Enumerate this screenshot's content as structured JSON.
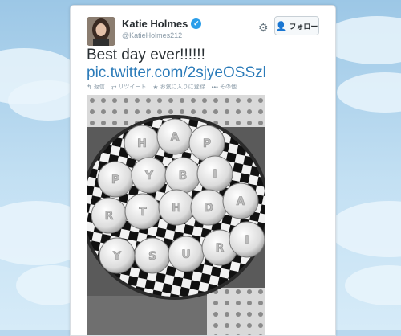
{
  "tweet": {
    "author_name": "Katie Holmes",
    "handle": "@KatieHolmes212",
    "follow_label": "フォロー",
    "text": "Best day ever!!!!!!",
    "link": "pic.twitter.com/2sjyeOSSzl",
    "actions": [
      {
        "icon": "reply-icon",
        "glyph": "↰",
        "label": "返信"
      },
      {
        "icon": "retweet-icon",
        "glyph": "⇄",
        "label": "リツイート"
      },
      {
        "icon": "favorite-icon",
        "glyph": "★",
        "label": "お気に入りに登録"
      },
      {
        "icon": "more-icon",
        "glyph": "•••",
        "label": "その他"
      }
    ]
  },
  "photo": {
    "cupcake_letters": [
      "H",
      "A",
      "P",
      "P",
      "Y",
      "B",
      "I",
      "R",
      "T",
      "H",
      "D",
      "A",
      "Y",
      "S",
      "U",
      "R",
      "I"
    ]
  },
  "colors": {
    "link": "#2b7bb9",
    "verified": "#2b9ee9",
    "background": "#b9d8ee"
  }
}
